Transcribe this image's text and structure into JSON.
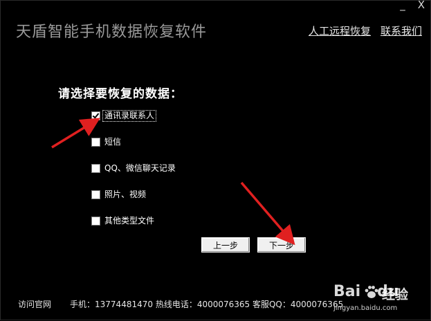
{
  "window": {
    "title": "天盾智能手机数据恢复软件",
    "minimize_label": "_",
    "close_label": "X"
  },
  "top_links": {
    "remote_recovery": "人工远程恢复",
    "contact_us": "联系我们"
  },
  "prompt": "请选择要恢复的数据：",
  "options": [
    {
      "label": "通讯录联系人",
      "checked": true
    },
    {
      "label": "短信",
      "checked": false
    },
    {
      "label": "QQ、微信聊天记录",
      "checked": false
    },
    {
      "label": "照片、视频",
      "checked": false
    },
    {
      "label": "其他类型文件",
      "checked": false
    }
  ],
  "buttons": {
    "prev": "上一步",
    "next": "下一步"
  },
  "footer": {
    "visit_site": "访问官网",
    "contact_line": "手机：13774481470 热线电话：4000076365 客服QQ：4000076365"
  },
  "watermark": {
    "brand_bai": "Bai",
    "brand_du": "du",
    "brand_cn": "经验",
    "url": "jingyan.baidu.com"
  },
  "colors": {
    "background": "#000000",
    "title": "#9a9a9a",
    "arrow": "#e02020"
  }
}
